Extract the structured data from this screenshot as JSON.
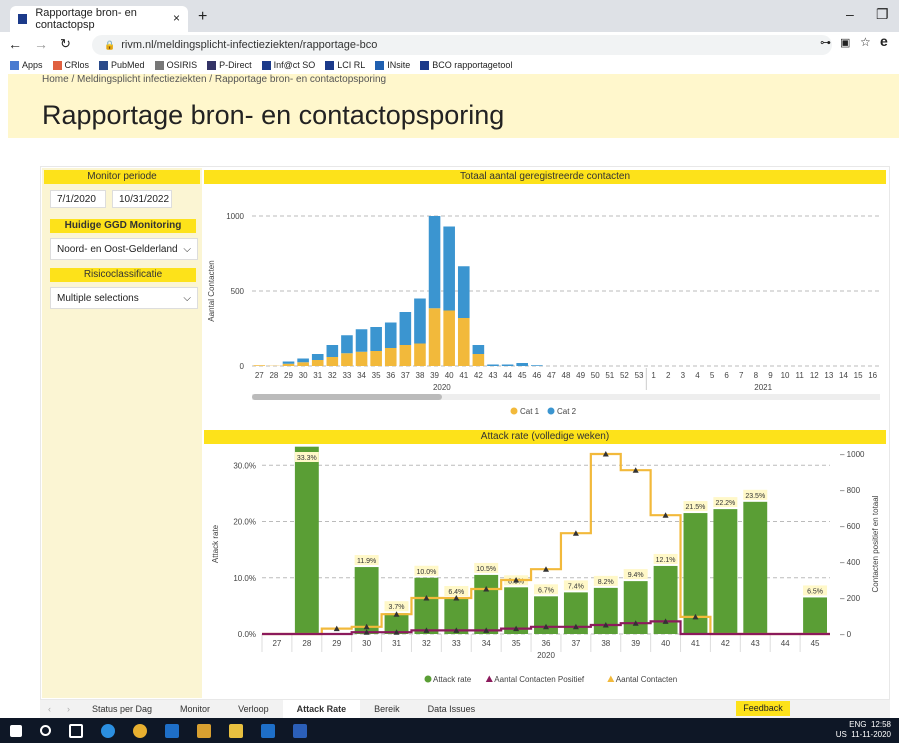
{
  "browser": {
    "tab_title": "Rapportage bron- en contactopsp",
    "url": "rivm.nl/meldingsplicht-infectieziekten/rapportage-bco",
    "bookmarks": [
      "Apps",
      "CRlos",
      "PubMed",
      "OSIRIS",
      "P-Direct",
      "Inf@ct SO",
      "LCI RL",
      "INsite",
      "BCO rapportagetool"
    ]
  },
  "page": {
    "breadcrumb": "Home  /  Meldingsplicht infectieziekten  /  Rapportage bron- en contactopsporing",
    "title": "Rapportage bron- en contactopsporing"
  },
  "filters": {
    "monitor_label": "Monitor periode",
    "date_from": "7/1/2020",
    "date_to": "10/31/2022",
    "ggd_label": "Huidige GGD Monitoring",
    "ggd_value": "Noord- en Oost-Gelderland",
    "risk_label": "Risicoclassificatie",
    "risk_value": "Multiple selections"
  },
  "chart_data": [
    {
      "type": "bar",
      "title": "Totaal aantal geregistreerde contacten",
      "ylabel": "Aantal Contacten",
      "ylim": [
        0,
        1000
      ],
      "yticks": [
        "0",
        "500",
        "1000"
      ],
      "categories": [
        "27",
        "28",
        "29",
        "30",
        "31",
        "32",
        "33",
        "34",
        "35",
        "36",
        "37",
        "38",
        "39",
        "40",
        "41",
        "42",
        "43",
        "44",
        "45",
        "46",
        "47",
        "48",
        "49",
        "50",
        "51",
        "52",
        "53",
        "1",
        "2",
        "3",
        "4",
        "5",
        "6",
        "7",
        "8",
        "9",
        "10",
        "11",
        "12",
        "13",
        "14",
        "15",
        "16"
      ],
      "year_labels": [
        "2020",
        "2021"
      ],
      "series": [
        {
          "name": "Cat 1",
          "color": "#f2b93b",
          "values": [
            5,
            2,
            15,
            25,
            40,
            60,
            85,
            95,
            100,
            120,
            140,
            150,
            385,
            370,
            320,
            80,
            0,
            0,
            0,
            0,
            0,
            0,
            0,
            0,
            0,
            0,
            0,
            0,
            0,
            0,
            0,
            0,
            0,
            0,
            0,
            0,
            0,
            0,
            0,
            0,
            0,
            0,
            0
          ]
        },
        {
          "name": "Cat 2",
          "color": "#3b95d0",
          "values": [
            0,
            0,
            15,
            25,
            40,
            80,
            120,
            150,
            160,
            170,
            220,
            300,
            615,
            560,
            345,
            60,
            10,
            10,
            20,
            5,
            0,
            0,
            0,
            0,
            0,
            0,
            0,
            0,
            0,
            0,
            0,
            0,
            0,
            0,
            0,
            0,
            0,
            0,
            0,
            0,
            0,
            0,
            0
          ]
        }
      ]
    },
    {
      "type": "bar",
      "title": "Attack rate (volledige weken)",
      "ylabel": "Attack rate",
      "y2label": "Contacten positief en totaal",
      "ylim": [
        0,
        32
      ],
      "y2lim": [
        0,
        1000
      ],
      "yticks": [
        "0.0%",
        "10.0%",
        "20.0%",
        "30.0%"
      ],
      "y2ticks": [
        "0",
        "200",
        "400",
        "600",
        "800",
        "1000"
      ],
      "xlabel": "2020",
      "categories": [
        "27",
        "28",
        "29",
        "30",
        "31",
        "32",
        "33",
        "34",
        "35",
        "36",
        "37",
        "38",
        "39",
        "40",
        "41",
        "42",
        "43",
        "44",
        "45"
      ],
      "series": [
        {
          "name": "Attack rate",
          "color": "#5a9e35",
          "values": [
            0,
            33.3,
            0,
            11.9,
            3.7,
            10.0,
            6.4,
            10.5,
            8.3,
            6.7,
            7.4,
            8.2,
            9.4,
            12.1,
            21.5,
            22.2,
            23.5,
            0,
            6.5
          ],
          "labels": [
            "",
            "33.3%",
            "",
            "11.9%",
            "3.7%",
            "10.0%",
            "6.4%",
            "10.5%",
            "8.3%",
            "6.7%",
            "7.4%",
            "8.2%",
            "9.4%",
            "12.1%",
            "21.5%",
            "22.2%",
            "23.5%",
            "",
            "6.5%"
          ]
        },
        {
          "name": "Aantal Contacten Positief",
          "color": "#8b1a5c",
          "values": [
            0,
            0,
            0,
            10,
            10,
            20,
            20,
            20,
            30,
            40,
            40,
            50,
            60,
            70,
            0,
            0,
            0,
            0,
            0
          ]
        },
        {
          "name": "Aantal Contacten",
          "color": "#f2b93b",
          "values": [
            0,
            0,
            30,
            40,
            110,
            200,
            200,
            250,
            300,
            360,
            560,
            1000,
            910,
            660,
            95,
            0,
            0,
            0,
            0
          ]
        }
      ]
    }
  ],
  "bottom_tabs": [
    "Status per Dag",
    "Monitor",
    "Verloop",
    "Attack Rate",
    "Bereik",
    "Data Issues"
  ],
  "active_tab": "Attack Rate",
  "feedback_label": "Feedback",
  "taskbar": {
    "lang": "ENG",
    "lang2": "US",
    "time": "12:58",
    "date": "11-11-2020"
  }
}
